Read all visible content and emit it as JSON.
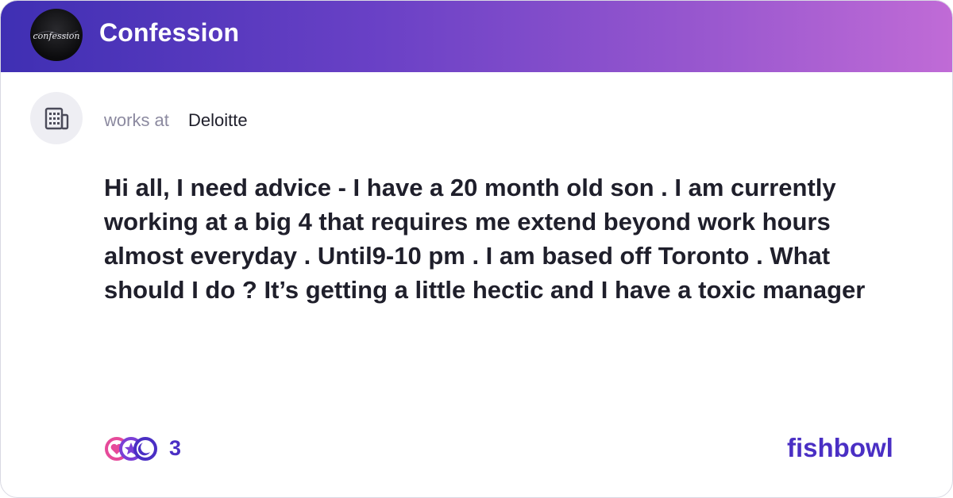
{
  "header": {
    "bowl_name": "Confession",
    "avatar_text": "confession",
    "colors": {
      "gradient_start": "#3f2fb3",
      "gradient_end": "#c06bd6"
    }
  },
  "author": {
    "works_at_label": "works at",
    "company": "Deloitte",
    "icon": "building-icon"
  },
  "post": {
    "text": "Hi all, I need advice - I have a 20 month old son . I am currently working at a big 4 that requires me extend beyond work hours almost everyday . Until9-10 pm . I am based off Toronto . What should I do ? It’s getting a little hectic and I have a toxic manager"
  },
  "footer": {
    "reaction_count": "3",
    "reaction_icons": [
      "heart-reaction-icon",
      "star-reaction-icon",
      "moon-reaction-icon"
    ],
    "brand": "fishbowl",
    "brand_color": "#4a2fc4"
  }
}
